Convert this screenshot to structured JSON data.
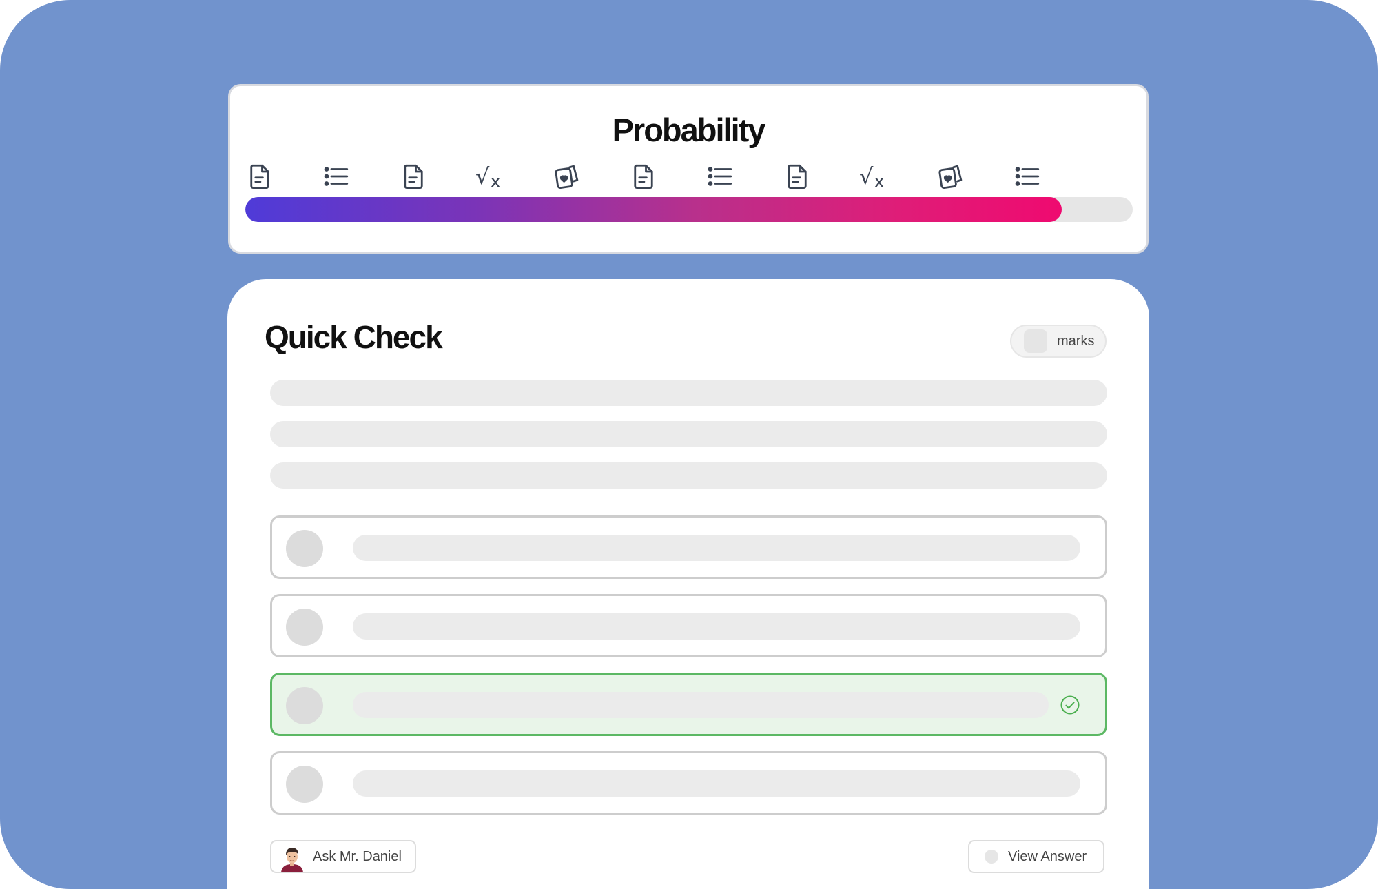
{
  "header": {
    "title": "Probability",
    "progress_percent": 92,
    "steps": [
      {
        "icon": "document-icon"
      },
      {
        "icon": "list-icon"
      },
      {
        "icon": "document-icon"
      },
      {
        "icon": "square-root-icon"
      },
      {
        "icon": "cards-icon"
      },
      {
        "icon": "document-icon"
      },
      {
        "icon": "list-icon"
      },
      {
        "icon": "document-icon"
      },
      {
        "icon": "square-root-icon"
      },
      {
        "icon": "cards-icon"
      },
      {
        "icon": "list-icon"
      }
    ]
  },
  "quiz": {
    "title": "Quick Check",
    "marks_label": "marks",
    "options": [
      {
        "state": "default"
      },
      {
        "state": "default"
      },
      {
        "state": "correct"
      },
      {
        "state": "default"
      }
    ],
    "ask_button": "Ask Mr. Daniel",
    "view_answer_button": "View Answer"
  },
  "colors": {
    "background": "#7193cd",
    "progress_start": "#4f3bd8",
    "progress_end": "#ef0a70",
    "correct_border": "#5cb864",
    "correct_fill": "#e9f5e9"
  }
}
